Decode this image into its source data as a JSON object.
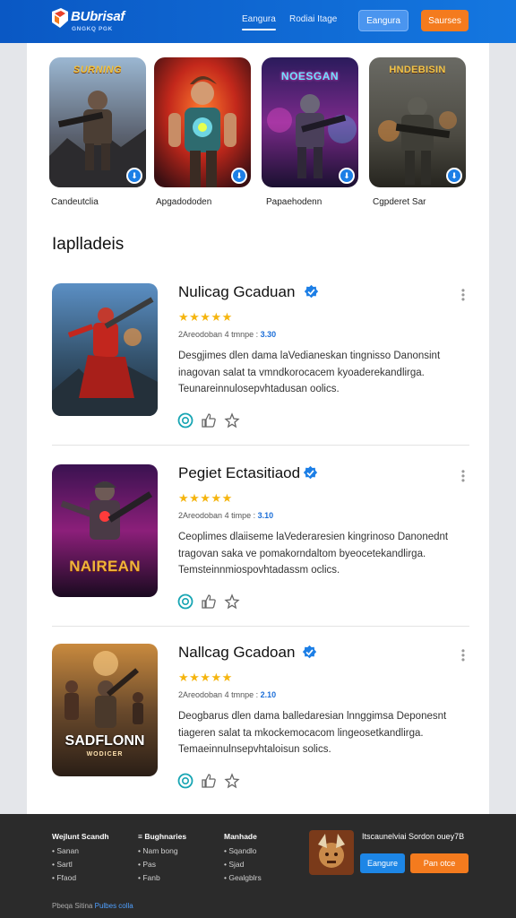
{
  "header": {
    "logo_name": "BUbrisaf",
    "logo_sub": "GNGKQ PGK",
    "nav": [
      "Eangura",
      "Rodiai Itage"
    ],
    "btn_primary": "Eangura",
    "btn_secondary": "Saurses"
  },
  "featured": [
    {
      "label": "Candeutclia",
      "art": "SURNING"
    },
    {
      "label": "Apgadododen",
      "art": ""
    },
    {
      "label": "Papaehodenn",
      "art": "NOESGAN"
    },
    {
      "label": "Cgpderet Sar",
      "art": "HNDEBISIN"
    }
  ],
  "section_title": "Iaplladeis",
  "games": [
    {
      "title": "Nulicag Gcaduan",
      "rating": "★★★★★",
      "meta_prefix": "2Areodoban",
      "meta_mid": "4 tmnpe :",
      "meta_num": "3.30",
      "desc": "Desgjimes dlen dama laVedianeskan tingnisso Danonsint inagovan salat ta vmndkorocacem kyoaderekandlirga. Teunareinnulosepvhtadusan oolics.",
      "art": ""
    },
    {
      "title": "Pegiet Ectasitiaod",
      "rating": "★★★★★",
      "meta_prefix": "2Areodoban",
      "meta_mid": "4 timpe :",
      "meta_num": "3.10",
      "desc": "Ceoplimes dlaiiseme laVederaresien kingrinoso Danonednt tragovan saka ve pomakorndaltom byeocetekandlirga. Temsteinnmiospovhtadassm oclics.",
      "art": "NAIREAN"
    },
    {
      "title": "Nallcag Gcadoan",
      "rating": "★★★★★",
      "meta_prefix": "2Areodoban",
      "meta_mid": "4 tmnpe :",
      "meta_num": "2.10",
      "desc": "Deogbarus dlen dama balledaresian lnnggimsa Deponesnt tiageren salat ta mkockemocacom lingeosetkandlirga. Temaeinnulnsepvhtaloisun solics.",
      "art": "SADFLONN"
    }
  ],
  "footer": {
    "columns": [
      {
        "title": "Wejlunt Scandh",
        "items": [
          "Sanan",
          "Sartl",
          "Ffaod"
        ]
      },
      {
        "title": "Bughnaries",
        "items": [
          "Nam bong",
          "Pas",
          "Fanb"
        ]
      },
      {
        "title": "Manhade",
        "items": [
          "Sqandlo",
          "Sjad",
          "Gealgblrs"
        ]
      }
    ],
    "promo_text": "Itscaunelviai Sordon ouey7B",
    "btn_primary": "Eangure",
    "btn_secondary": "Pan otce",
    "copyright": "Pbeqa Sitina",
    "copyright_link": "Pulbes colla"
  },
  "colors": {
    "brand_blue": "#0a58c4",
    "accent_orange": "#f47b1e",
    "star_gold": "#f5b50f",
    "footer_bg": "#2b2b2b"
  },
  "icons": [
    "verified-badge-icon",
    "star-icon",
    "comment-icon",
    "thumbs-up-icon",
    "share-icon",
    "more-vertical-icon",
    "download-badge-icon"
  ]
}
